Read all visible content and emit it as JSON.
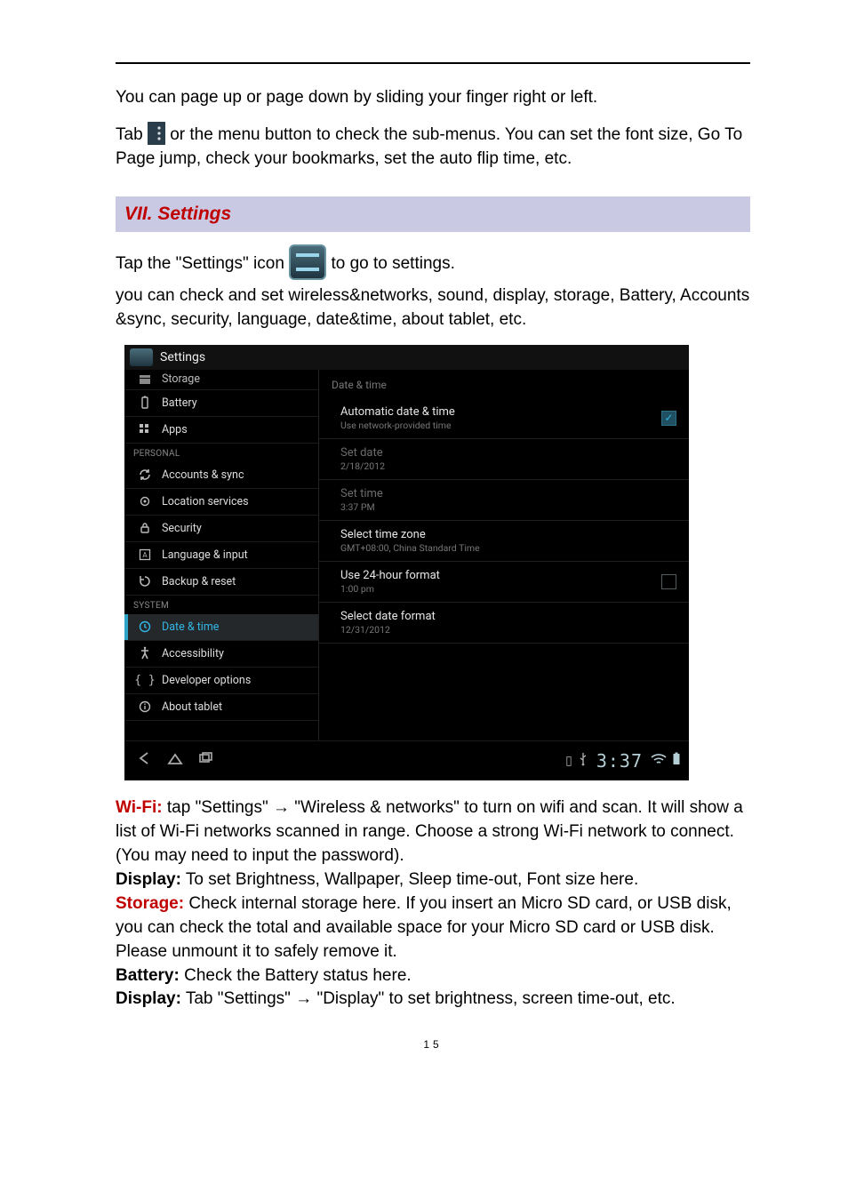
{
  "doc": {
    "p1": "You can page up or page down by sliding your finger right or left.",
    "p2a": "Tab ",
    "p2b": " or the menu button to check the sub-menus. You can set the font size, Go To Page jump, check your bookmarks, set the auto flip time, etc.",
    "section_title": "VII. Settings",
    "p3a": "Tap the \"Settings\" icon ",
    "p3b": " to go to settings.",
    "p4": "you can check and set wireless&networks, sound, display, storage, Battery, Accounts &sync, security, language, date&time, about tablet, etc.",
    "wifi": {
      "key": "Wi-Fi:",
      "text": "  tap \"Settings\" →   \"Wireless & networks\" to turn on wifi and scan. It will show a list of Wi-Fi networks scanned in range.   Choose a strong Wi-Fi network to connect. (You may need to input the password)."
    },
    "display1": {
      "key": "Display:",
      "text": " To set Brightness, Wallpaper, Sleep time-out,   Font size here."
    },
    "storage": {
      "key": "Storage:",
      "text": " Check internal storage here. If you insert an Micro SD card, or USB disk, you can check the total and available space for your Micro SD card or USB disk.   Please unmount it to safely remove it."
    },
    "battery": {
      "key": "Battery:",
      "text": " Check the Battery status here."
    },
    "display2": {
      "key": "Display:",
      "text": " Tab \"Settings\" →   \"Display\" to set brightness, screen time-out, etc."
    },
    "page_number": "15"
  },
  "shot": {
    "title": "Settings",
    "sidebar": {
      "items": [
        {
          "label": "Storage",
          "icon": "storage"
        },
        {
          "label": "Battery",
          "icon": "battery"
        },
        {
          "label": "Apps",
          "icon": "apps"
        }
      ],
      "personal_label": "PERSONAL",
      "personal": [
        {
          "label": "Accounts & sync",
          "icon": "sync"
        },
        {
          "label": "Location services",
          "icon": "location"
        },
        {
          "label": "Security",
          "icon": "lock"
        },
        {
          "label": "Language & input",
          "icon": "lang"
        },
        {
          "label": "Backup & reset",
          "icon": "restore"
        }
      ],
      "system_label": "SYSTEM",
      "system": [
        {
          "label": "Date & time",
          "icon": "clock",
          "selected": true
        },
        {
          "label": "Accessibility",
          "icon": "hand"
        },
        {
          "label": "Developer options",
          "icon": "braces"
        },
        {
          "label": "About tablet",
          "icon": "info"
        }
      ]
    },
    "panel": {
      "header": "Date & time",
      "auto": {
        "title": "Automatic date & time",
        "sub": "Use network-provided time",
        "checked": true
      },
      "setdate": {
        "title": "Set date",
        "sub": "2/18/2012"
      },
      "settime": {
        "title": "Set time",
        "sub": "3:37 PM"
      },
      "tz": {
        "title": "Select time zone",
        "sub": "GMT+08:00, China Standard Time"
      },
      "h24": {
        "title": "Use 24-hour format",
        "sub": "1:00 pm",
        "checked": false
      },
      "datefmt": {
        "title": "Select date format",
        "sub": "12/31/2012"
      }
    },
    "nav": {
      "clock": "3:37"
    }
  }
}
